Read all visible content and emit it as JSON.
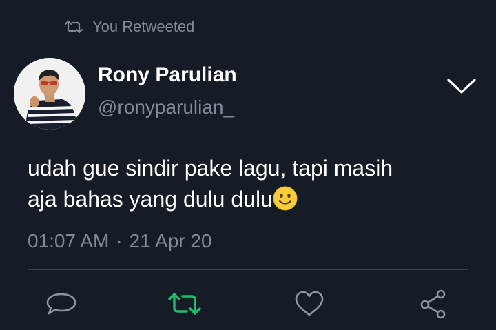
{
  "retweet_context": {
    "label": "You Retweeted",
    "icon": "retweet-icon"
  },
  "tweet": {
    "author": {
      "name": "Rony Parulian",
      "handle": "@ronyparulian_",
      "avatar": "profile-photo"
    },
    "text_line_1": "udah gue sindir pake lagu, tapi masih",
    "text_line_2": "aja bahas yang dulu dulu",
    "emoji": "slightly-smiling-face",
    "time": "01:07 AM",
    "separator": "·",
    "date": "21 Apr 20"
  },
  "actions": [
    {
      "icon": "reply-icon",
      "active": false
    },
    {
      "icon": "retweet-icon",
      "active": true
    },
    {
      "icon": "like-icon",
      "active": false
    },
    {
      "icon": "share-icon",
      "active": false
    }
  ],
  "colors": {
    "background": "#151c25",
    "text": "#ffffff",
    "muted": "#7f8b96",
    "retweet_active": "#1bbf6b",
    "divider": "#3a4654"
  }
}
